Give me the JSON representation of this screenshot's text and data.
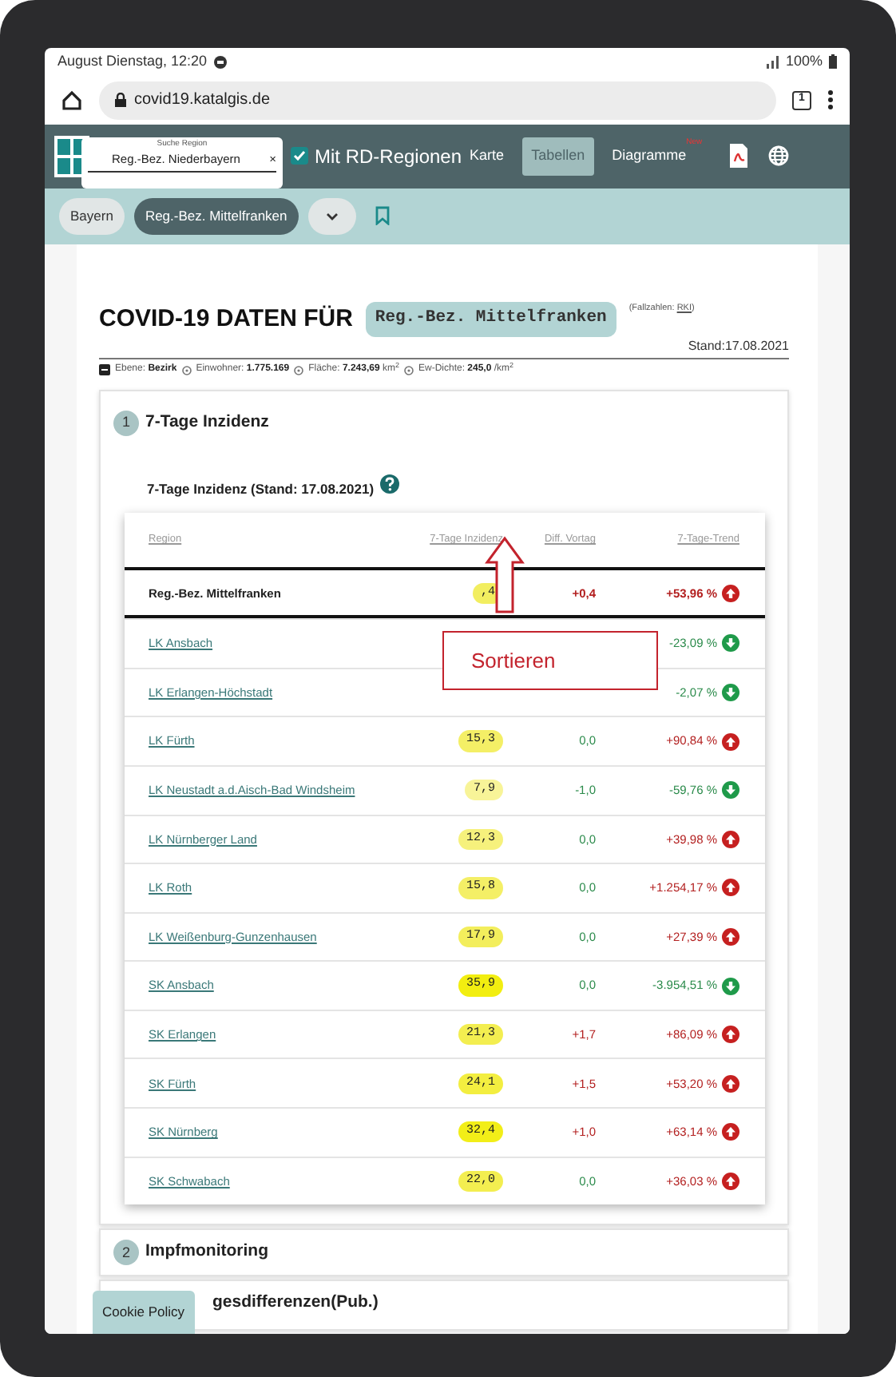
{
  "device_status": {
    "time": "August Dienstag, 12:20",
    "battery": "100%"
  },
  "browser": {
    "url": "covid19.katalgis.de",
    "tab_count": "1"
  },
  "app_bar": {
    "search": {
      "label": "Suche Region",
      "value": "Reg.-Bez. Niederbayern",
      "clear": "×"
    },
    "rd_regions": {
      "label": "Mit RD-Regionen",
      "checked": true
    },
    "nav": [
      {
        "label": "Karte",
        "selected": false
      },
      {
        "label": "Tabellen",
        "selected": true
      },
      {
        "label": "Diagramme",
        "badge": "New",
        "selected": false
      }
    ]
  },
  "breadcrumbs": [
    {
      "label": "Bayern",
      "selected": false
    },
    {
      "label": "Reg.-Bez. Mittelfranken",
      "selected": true
    }
  ],
  "heading": {
    "title": "COVID-19 DATEN FÜR",
    "region": "Reg.-Bez. Mittelfranken",
    "source_before": "(Fallzahlen: ",
    "source_link": "RKI",
    "source_after": ")",
    "stand": "Stand:17.08.2021"
  },
  "facts": [
    {
      "text": "Ebene: **Bezirk**",
      "info": true
    },
    {
      "text": "Einwohner: **1.775.169**",
      "info": true
    },
    {
      "text": "Fläche: **7.243,69** km$^{2}$",
      "info": true
    },
    {
      "text": "Ew-Dichte: **245,0** /km$^{2}$",
      "info": false
    }
  ],
  "sections": [
    {
      "number": "1",
      "title": "7-Tage Inzidenz"
    },
    {
      "number": "2",
      "title": "Impfmonitoring"
    },
    {
      "title": "gesdifferenzen(Pub.)"
    }
  ],
  "table": {
    "caption": "7-Tage Inzidenz (Stand: 17.08.2021)",
    "columns": [
      "Region",
      "7-Tage Inzidenz",
      "Diff. Vortag",
      "7-Tage-Trend"
    ],
    "total": {
      "region": "Reg.-Bez. Mittelfranken",
      "incidence": ",4",
      "color": "#f2ee60",
      "diff": "+0,4",
      "diff_rising": true,
      "trend": "+53,96 %",
      "trend_up": true
    },
    "rows": [
      {
        "region": "LK Ansbach",
        "trend": "-23,09 %",
        "trend_up": false
      },
      {
        "region": "LK Erlangen-Höchstadt",
        "trend": "-2,07 %",
        "trend_up": false
      },
      {
        "region": "LK Fürth",
        "incidence": "15,3",
        "color": "#f4ef66",
        "diff": "0,0",
        "diff_rising": false,
        "trend": "+90,84 %",
        "trend_up": true
      },
      {
        "region": "LK Neustadt a.d.Aisch-Bad Windsheim",
        "incidence": "7,9",
        "color": "#f8f498",
        "diff": "-1,0",
        "diff_rising": false,
        "trend": "-59,76 %",
        "trend_up": false
      },
      {
        "region": "LK Nürnberger Land",
        "incidence": "12,3",
        "color": "#f6f17c",
        "diff": "0,0",
        "diff_rising": false,
        "trend": "+39,98 %",
        "trend_up": true
      },
      {
        "region": "LK Roth",
        "incidence": "15,8",
        "color": "#f4ef66",
        "diff": "0,0",
        "diff_rising": false,
        "trend": "+1.254,17 %",
        "trend_up": true
      },
      {
        "region": "LK Weißenburg-Gunzenhausen",
        "incidence": "17,9",
        "color": "#f3ee5c",
        "diff": "0,0",
        "diff_rising": false,
        "trend": "+27,39 %",
        "trend_up": true
      },
      {
        "region": "SK Ansbach",
        "incidence": "35,9",
        "color": "#f2ee10",
        "diff": "0,0",
        "diff_rising": false,
        "trend": "-3.954,51 %",
        "trend_up": false
      },
      {
        "region": "SK Erlangen",
        "incidence": "21,3",
        "color": "#f3ee50",
        "diff": "+1,7",
        "diff_rising": true,
        "trend": "+86,09 %",
        "trend_up": true
      },
      {
        "region": "SK Fürth",
        "incidence": "24,1",
        "color": "#f3ee40",
        "diff": "+1,5",
        "diff_rising": true,
        "trend": "+53,20 %",
        "trend_up": true
      },
      {
        "region": "SK Nürnberg",
        "incidence": "32,4",
        "color": "#f2ee18",
        "diff": "+1,0",
        "diff_rising": true,
        "trend": "+63,14 %",
        "trend_up": true
      },
      {
        "region": "SK Schwabach",
        "incidence": "22,0",
        "color": "#f3ee50",
        "diff": "0,0",
        "diff_rising": false,
        "trend": "+36,03 %",
        "trend_up": true
      }
    ]
  },
  "annotation": {
    "label": "Sortieren"
  },
  "cookie_button": "Cookie Policy"
}
